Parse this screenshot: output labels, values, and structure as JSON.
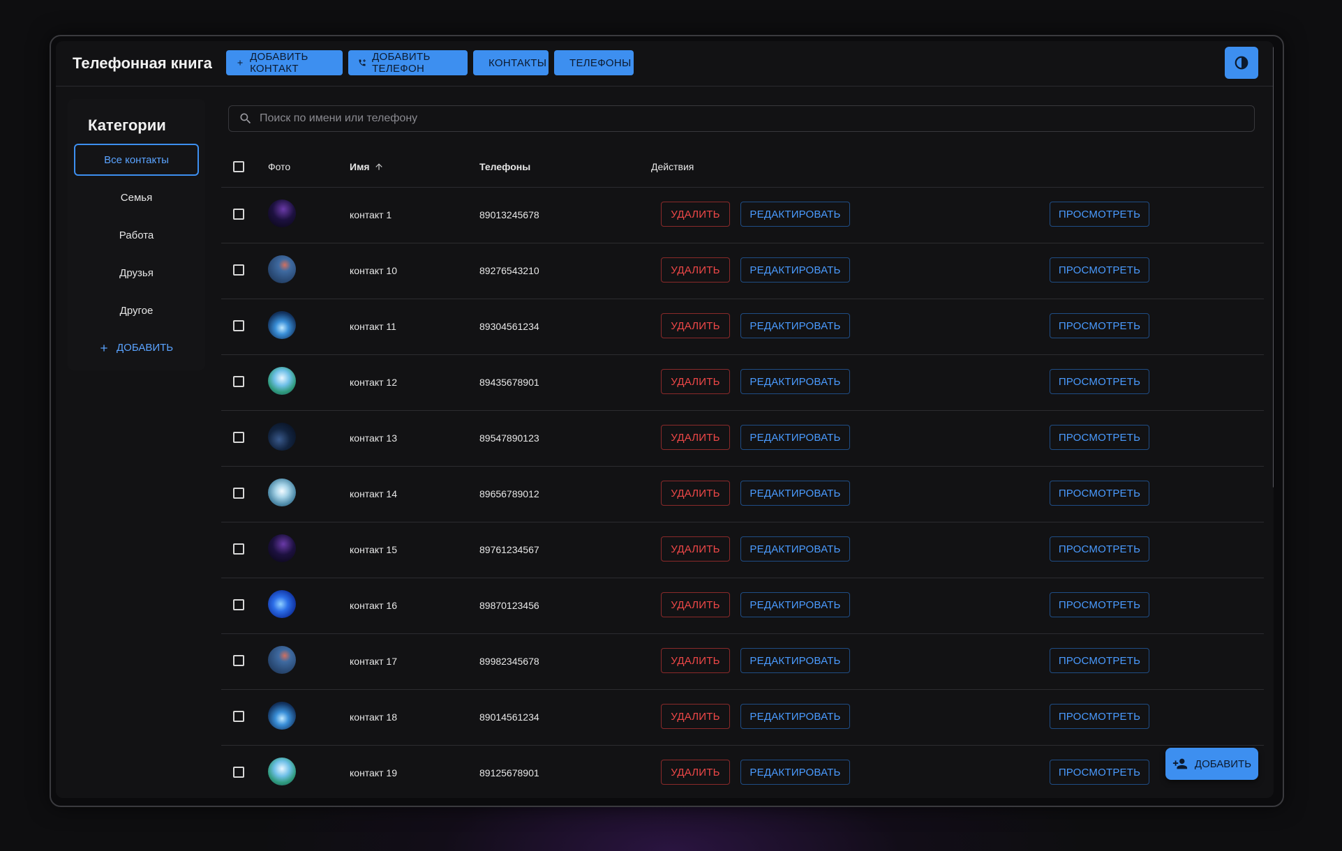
{
  "app": {
    "title": "Телефонная книга"
  },
  "toolbar": {
    "add_contact": "ДОБАВИТЬ КОНТАКТ",
    "add_phone": "ДОБАВИТЬ ТЕЛЕФОН",
    "contacts": "КОНТАКТЫ",
    "phones": "ТЕЛЕФОНЫ"
  },
  "sidebar": {
    "title": "Категории",
    "items": [
      {
        "label": "Все контакты",
        "active": true
      },
      {
        "label": "Семья"
      },
      {
        "label": "Работа"
      },
      {
        "label": "Друзья"
      },
      {
        "label": "Другое"
      }
    ],
    "add_label": "ДОБАВИТЬ"
  },
  "search": {
    "placeholder": "Поиск по имени или телефону",
    "value": ""
  },
  "table": {
    "headers": {
      "photo": "Фото",
      "name": "Имя",
      "phones": "Телефоны",
      "actions": "Действия"
    },
    "sort": {
      "column": "name",
      "direction": "asc"
    },
    "actions": {
      "delete": "УДАЛИТЬ",
      "edit": "РЕДАКТИРОВАТЬ",
      "view": "ПРОСМОТРЕТЬ"
    },
    "rows": [
      {
        "name": "контакт 1",
        "phone": "89013245678",
        "avatar": "space"
      },
      {
        "name": "контакт 10",
        "phone": "89276543210",
        "avatar": "mountain"
      },
      {
        "name": "контакт 11",
        "phone": "89304561234",
        "avatar": "ice"
      },
      {
        "name": "контакт 12",
        "phone": "89435678901",
        "avatar": "lake"
      },
      {
        "name": "контакт 13",
        "phone": "89547890123",
        "avatar": "night"
      },
      {
        "name": "контакт 14",
        "phone": "89656789012",
        "avatar": "sea"
      },
      {
        "name": "контакт 15",
        "phone": "89761234567",
        "avatar": "space"
      },
      {
        "name": "контакт 16",
        "phone": "89870123456",
        "avatar": "wave"
      },
      {
        "name": "контакт 17",
        "phone": "89982345678",
        "avatar": "mountain"
      },
      {
        "name": "контакт 18",
        "phone": "89014561234",
        "avatar": "ice"
      },
      {
        "name": "контакт 19",
        "phone": "89125678901",
        "avatar": "lake"
      }
    ]
  },
  "fab": {
    "label": "ДОБАВИТЬ"
  },
  "colors": {
    "accent": "#3d8ff0",
    "danger": "#f04848",
    "background": "#121214"
  }
}
